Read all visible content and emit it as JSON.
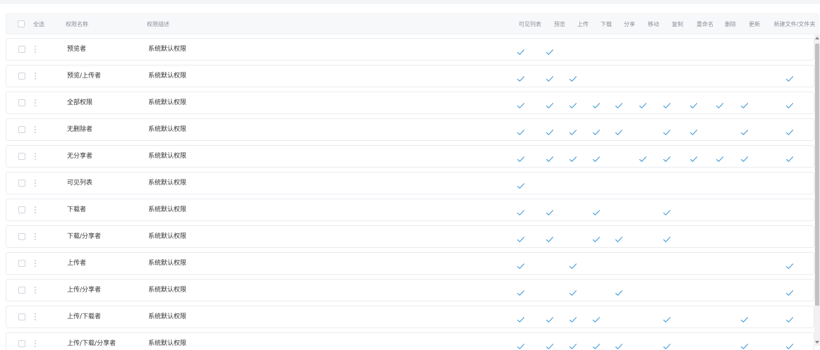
{
  "header": {
    "select_all": "全选",
    "col_name": "权限名称",
    "col_desc": "权限描述",
    "permissions": [
      "可见列表",
      "预览",
      "上传",
      "下载",
      "分享",
      "移动",
      "复制",
      "重命名",
      "删除",
      "更新",
      "新建文件/文件夹"
    ]
  },
  "check_color": "#2b8fd6",
  "rows": [
    {
      "name": "预览者",
      "desc": "系统默认权限",
      "checks": [
        1,
        1,
        0,
        0,
        0,
        0,
        0,
        0,
        0,
        0,
        0
      ]
    },
    {
      "name": "预览/上传者",
      "desc": "系统默认权限",
      "checks": [
        1,
        1,
        1,
        0,
        0,
        0,
        0,
        0,
        0,
        0,
        1
      ]
    },
    {
      "name": "全部权限",
      "desc": "系统默认权限",
      "checks": [
        1,
        1,
        1,
        1,
        1,
        1,
        1,
        1,
        1,
        1,
        1
      ]
    },
    {
      "name": "无删除者",
      "desc": "系统默认权限",
      "checks": [
        1,
        1,
        1,
        1,
        1,
        0,
        1,
        1,
        0,
        1,
        1
      ]
    },
    {
      "name": "无分享者",
      "desc": "系统默认权限",
      "checks": [
        1,
        1,
        1,
        1,
        0,
        1,
        1,
        1,
        1,
        1,
        1
      ]
    },
    {
      "name": "可见列表",
      "desc": "系统默认权限",
      "checks": [
        1,
        0,
        0,
        0,
        0,
        0,
        0,
        0,
        0,
        0,
        0
      ]
    },
    {
      "name": "下载者",
      "desc": "系统默认权限",
      "checks": [
        1,
        1,
        0,
        1,
        0,
        0,
        1,
        0,
        0,
        0,
        0
      ]
    },
    {
      "name": "下载/分享者",
      "desc": "系统默认权限",
      "checks": [
        1,
        1,
        0,
        1,
        1,
        0,
        1,
        0,
        0,
        0,
        0
      ]
    },
    {
      "name": "上传者",
      "desc": "系统默认权限",
      "checks": [
        1,
        0,
        1,
        0,
        0,
        0,
        0,
        0,
        0,
        0,
        1
      ]
    },
    {
      "name": "上传/分享者",
      "desc": "系统默认权限",
      "checks": [
        1,
        0,
        1,
        0,
        1,
        0,
        0,
        0,
        0,
        0,
        1
      ]
    },
    {
      "name": "上传/下载者",
      "desc": "系统默认权限",
      "checks": [
        1,
        1,
        1,
        1,
        0,
        0,
        1,
        0,
        0,
        1,
        1
      ]
    },
    {
      "name": "上传/下载/分享者",
      "desc": "系统默认权限",
      "checks": [
        1,
        1,
        1,
        1,
        1,
        0,
        1,
        0,
        0,
        1,
        1
      ]
    }
  ]
}
